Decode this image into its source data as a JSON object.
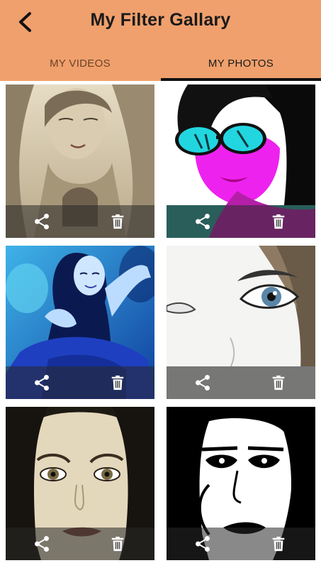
{
  "header": {
    "title": "My Filter Gallary",
    "back_icon": "arrow-back-icon",
    "background": "#f0a06d"
  },
  "tabs": [
    {
      "label": "MY VIDEOS",
      "selected": false
    },
    {
      "label": "MY PHOTOS",
      "selected": true
    }
  ],
  "gallery": {
    "items": [
      {
        "filter": "sepia sketch",
        "actions": [
          "share-icon",
          "delete-icon"
        ]
      },
      {
        "filter": "pop art magenta/cyan",
        "actions": [
          "share-icon",
          "delete-icon"
        ]
      },
      {
        "filter": "blue tint",
        "actions": [
          "share-icon",
          "delete-icon"
        ]
      },
      {
        "filter": "white sketch",
        "actions": [
          "share-icon",
          "delete-icon"
        ]
      },
      {
        "filter": "sepia portrait",
        "actions": [
          "share-icon",
          "delete-icon"
        ]
      },
      {
        "filter": "black & white threshold",
        "actions": [
          "share-icon",
          "delete-icon"
        ]
      }
    ]
  }
}
